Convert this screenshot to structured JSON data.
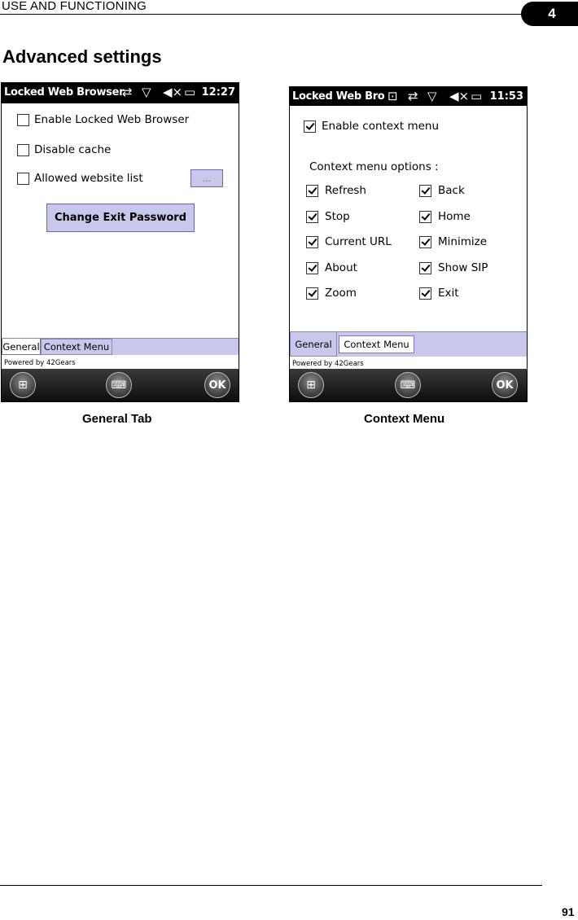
{
  "header": {
    "chapter_title": "USE AND FUNCTIONING",
    "chapter_number": "4"
  },
  "section_title": "Advanced settings",
  "screen1": {
    "app_title": "Locked Web Browser",
    "time": "12:27",
    "status_icons": [
      "sync-icon",
      "no-signal-icon",
      "mute-icon",
      "battery-icon"
    ],
    "checkboxes": [
      {
        "label": "Enable Locked Web Browser",
        "checked": false
      },
      {
        "label": "Disable cache",
        "checked": false
      },
      {
        "label": "Allowed website list",
        "checked": false
      }
    ],
    "browse_button": "...",
    "password_button": "Change Exit Password",
    "tabs": [
      "General",
      "Context Menu"
    ],
    "active_tab": "General",
    "powered_by": "Powered by 42Gears",
    "ok_label": "OK",
    "caption": "General Tab"
  },
  "screen2": {
    "app_title": "Locked Web Bro",
    "time": "11:53",
    "status_icons": [
      "notification-icon",
      "sync-icon",
      "no-signal-icon",
      "mute-icon",
      "battery-icon"
    ],
    "enable_context_menu": {
      "label": "Enable context menu",
      "checked": true
    },
    "options_heading": "Context menu options :",
    "options_left": [
      "Refresh",
      "Stop",
      "Current URL",
      "About",
      "Zoom"
    ],
    "options_right": [
      "Back",
      "Home",
      "Minimize",
      "Show SIP",
      "Exit"
    ],
    "tabs": [
      "General",
      "Context Menu"
    ],
    "active_tab": "Context Menu",
    "powered_by": "Powered by 42Gears",
    "ok_label": "OK",
    "caption": "Context Menu"
  },
  "footer": {
    "page_number": "91"
  }
}
